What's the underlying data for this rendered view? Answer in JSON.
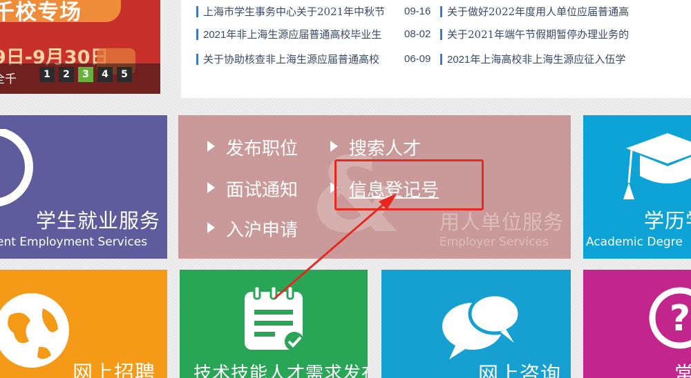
{
  "banner": {
    "title": "千校专场",
    "date": "9日-9月30日",
    "caption": "全千",
    "pages": [
      "1",
      "2",
      "3",
      "4",
      "5"
    ],
    "active_page": "3"
  },
  "news": {
    "left": [
      {
        "title": "上海市学生事务中心关于2021年中秋节"
      },
      {
        "title": "2021年非上海生源应届普通高校毕业生"
      },
      {
        "title": "关于协助核查非上海生源应届普通高校"
      }
    ],
    "right": [
      {
        "date": "09-16",
        "title": "关于做好2022年度用人单位应届普通高"
      },
      {
        "date": "08-02",
        "title": "关于2021年端午节假期暂停办理业务的"
      },
      {
        "date": "06-09",
        "title": "2021年上海高校非上海生源应征入伍学"
      }
    ]
  },
  "tiles": {
    "student": {
      "cn": "学生就业服务",
      "en": "ent Employment Services"
    },
    "employer": {
      "links": [
        "发布职位",
        "搜索人才",
        "面试通知",
        "信息登记号",
        "入沪申请"
      ],
      "cn": "用人单位服务",
      "en": "Employer Services"
    },
    "academic": {
      "cn": "学历学",
      "en": "Academic Degre"
    },
    "recruit": {
      "cn": "网上招聘"
    },
    "tech": {
      "cn": "技术技能人才需求发布"
    },
    "consult": {
      "cn": "网上咨询"
    },
    "magenta": {
      "cn": "常"
    }
  },
  "annotation": {
    "color": "#e8271e"
  }
}
